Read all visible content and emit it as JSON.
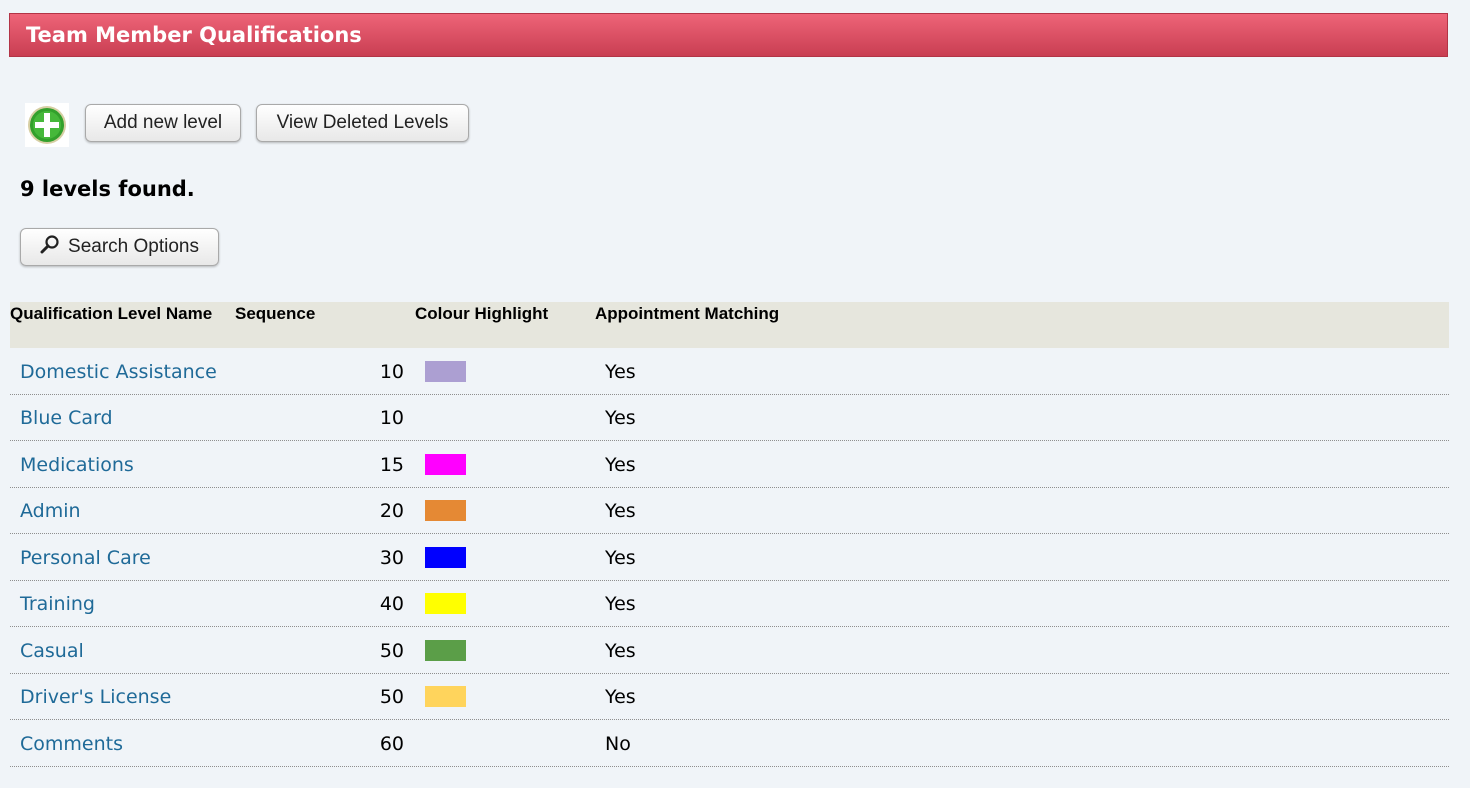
{
  "header": {
    "title": "Team Member Qualifications"
  },
  "toolbar": {
    "add_label": "Add new level",
    "deleted_label": "View Deleted Levels",
    "add_icon": "plus-circle-icon"
  },
  "results": {
    "count_text": "9 levels found."
  },
  "search": {
    "label": "Search Options",
    "icon": "magnifier-icon"
  },
  "table": {
    "columns": [
      "Qualification Level Name",
      "Sequence",
      "Colour Highlight",
      "Appointment Matching"
    ],
    "rows": [
      {
        "name": "Domestic Assistance",
        "sequence": "10",
        "colour": "#ac9fd2",
        "matching": "Yes"
      },
      {
        "name": "Blue Card",
        "sequence": "10",
        "colour": "",
        "matching": "Yes"
      },
      {
        "name": "Medications",
        "sequence": "15",
        "colour": "#ff00ff",
        "matching": "Yes"
      },
      {
        "name": "Admin",
        "sequence": "20",
        "colour": "#e58934",
        "matching": "Yes"
      },
      {
        "name": "Personal Care",
        "sequence": "30",
        "colour": "#0000ff",
        "matching": "Yes"
      },
      {
        "name": "Training",
        "sequence": "40",
        "colour": "#ffff00",
        "matching": "Yes"
      },
      {
        "name": "Casual",
        "sequence": "50",
        "colour": "#5b9e48",
        "matching": "Yes"
      },
      {
        "name": "Driver's License",
        "sequence": "50",
        "colour": "#ffd45c",
        "matching": "Yes"
      },
      {
        "name": "Comments",
        "sequence": "60",
        "colour": "",
        "matching": "No"
      }
    ]
  }
}
